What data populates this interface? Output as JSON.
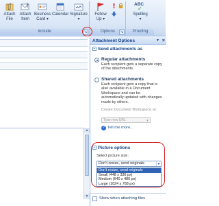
{
  "ribbon": {
    "groups": {
      "include": "Include",
      "options": "Options",
      "proofing": "Proofing"
    },
    "buttons": {
      "attach_file": [
        "Attach",
        "File"
      ],
      "attach_item": [
        "Attach",
        "Item"
      ],
      "business_card": [
        "Business",
        "Card ▾"
      ],
      "calendar": [
        "Calendar",
        ""
      ],
      "signature": [
        "Signature",
        "▾"
      ],
      "follow_up": [
        "Follow",
        "Up ▾"
      ],
      "spelling": [
        "Spelling",
        "▾"
      ]
    },
    "abc_text": "ABC"
  },
  "pane": {
    "title": "Attachment Options",
    "send_section": "Send attachments as",
    "regular": {
      "label": "Regular attachments",
      "desc": "Each recipient gets a separate copy of the attachments.",
      "selected": true
    },
    "shared": {
      "label": "Shared attachments",
      "desc": "Each recipient gets a copy that is also available in a Document Workspace and can be automatically updated with changes made by others.",
      "create_label": "Create Document Workspace at:",
      "combo_value": "Type new URL",
      "link": "Tell me more..."
    },
    "picture_section": "Picture options",
    "select_label": "Select picture size:",
    "select_value": "Don't resize, send originals",
    "options": [
      "Don't resize, send originals",
      "Small (448 x 336 px)",
      "Medium (640 x 480 px)",
      "Large (1024 x 768 px)"
    ],
    "selected_index": 0,
    "show_when_attaching": "Show when attaching files"
  },
  "colors": {
    "highlight_circle": "#d2232a",
    "selection": "#3163b4",
    "ribbon_accent": "#8db2e3"
  }
}
